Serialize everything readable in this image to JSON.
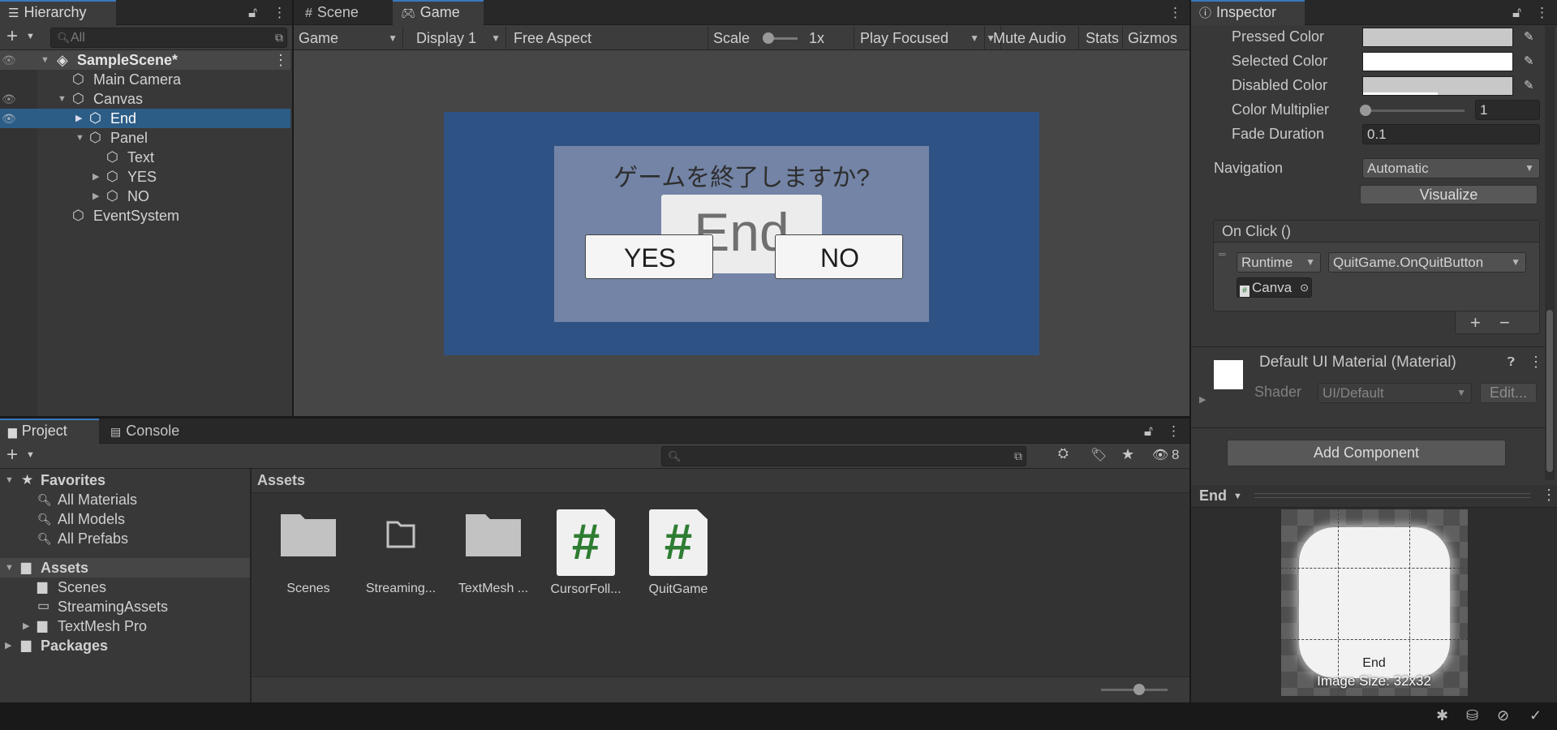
{
  "hierarchy": {
    "tab": "Hierarchy",
    "search_placeholder": "All",
    "items": [
      {
        "label": "SampleScene*"
      },
      {
        "label": "Main Camera"
      },
      {
        "label": "Canvas"
      },
      {
        "label": "End"
      },
      {
        "label": "Panel"
      },
      {
        "label": "Text"
      },
      {
        "label": "YES"
      },
      {
        "label": "NO"
      },
      {
        "label": "EventSystem"
      }
    ]
  },
  "viewTabs": {
    "scene": "Scene",
    "game": "Game"
  },
  "gameToolbar": {
    "game": "Game",
    "display": "Display 1",
    "aspect": "Free Aspect",
    "scale_label": "Scale",
    "scale_value": "1x",
    "play_focused": "Play Focused",
    "mute": "Mute Audio",
    "stats": "Stats",
    "gizmos": "Gizmos"
  },
  "gameView": {
    "question": "ゲームを終了しますか?",
    "end_button": "End",
    "yes_button": "YES",
    "no_button": "NO"
  },
  "inspector": {
    "tab": "Inspector",
    "pressed_color": "Pressed Color",
    "selected_color": "Selected Color",
    "disabled_color": "Disabled Color",
    "color_multiplier": "Color Multiplier",
    "color_multiplier_value": "1",
    "fade_duration": "Fade Duration",
    "fade_duration_value": "0.1",
    "navigation": "Navigation",
    "navigation_value": "Automatic",
    "visualize": "Visualize",
    "onclick": "On Click ()",
    "runtime": "Runtime",
    "function": "QuitGame.OnQuitButton",
    "object": "Canva",
    "material_title": "Default UI Material (Material)",
    "shader_label": "Shader",
    "shader_value": "UI/Default",
    "edit": "Edit...",
    "add_component": "Add Component",
    "preview_title": "End",
    "preview_name": "End",
    "image_size": "Image Size: 32x32"
  },
  "project": {
    "tab_project": "Project",
    "tab_console": "Console",
    "hidden_count": "8",
    "breadcrumb": "Assets",
    "tree": [
      {
        "label": "Favorites"
      },
      {
        "label": "All Materials"
      },
      {
        "label": "All Models"
      },
      {
        "label": "All Prefabs"
      },
      {
        "label": "Assets"
      },
      {
        "label": "Scenes"
      },
      {
        "label": "StreamingAssets"
      },
      {
        "label": "TextMesh Pro"
      },
      {
        "label": "Packages"
      }
    ],
    "assets": [
      {
        "label": "Scenes"
      },
      {
        "label": "Streaming..."
      },
      {
        "label": "TextMesh ..."
      },
      {
        "label": "CursorFoll..."
      },
      {
        "label": "QuitGame"
      }
    ]
  },
  "colors": {
    "accent": "#3a79bb",
    "selection": "#2c5d87",
    "game_bg": "#2f5284",
    "dialog": "#7384a6"
  }
}
